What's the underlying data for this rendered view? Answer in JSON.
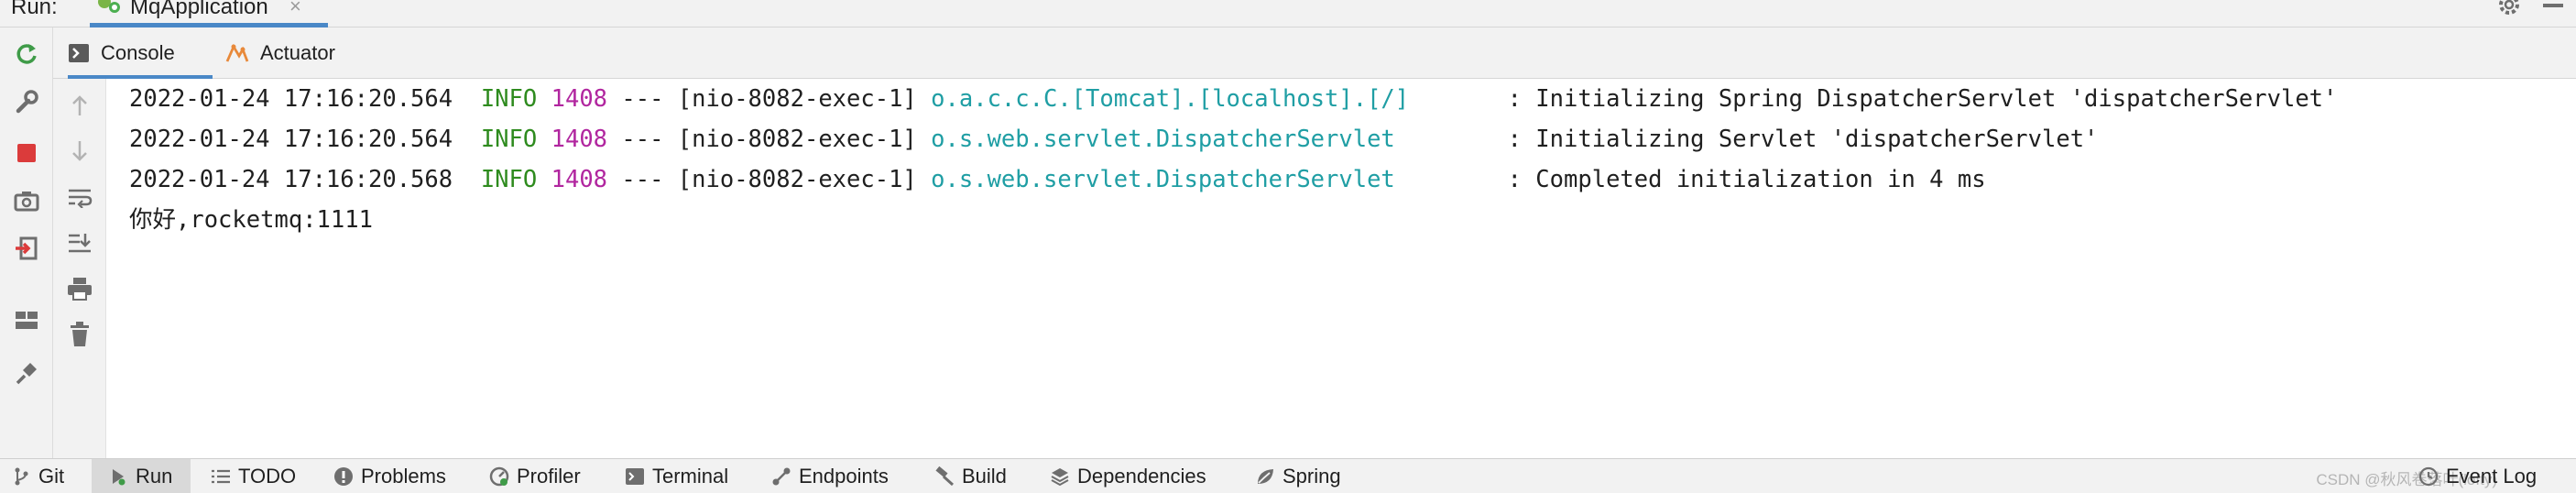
{
  "run_header": {
    "label": "Run:",
    "tab_title": "MqApplication",
    "tab_close": "×"
  },
  "sub_tabs": [
    {
      "label": "Console",
      "active": true
    },
    {
      "label": "Actuator",
      "active": false
    }
  ],
  "console_lines": [
    {
      "timestamp": "2022-01-24 17:16:20.564",
      "level": "INFO",
      "pid": "1408",
      "thread": "--- [nio-8082-exec-1]",
      "logger": "o.a.c.c.C.[Tomcat].[localhost].[/]      ",
      "message": " : Initializing Spring DispatcherServlet 'dispatcherServlet'"
    },
    {
      "timestamp": "2022-01-24 17:16:20.564",
      "level": "INFO",
      "pid": "1408",
      "thread": "--- [nio-8082-exec-1]",
      "logger": "o.s.web.servlet.DispatcherServlet       ",
      "message": " : Initializing Servlet 'dispatcherServlet'"
    },
    {
      "timestamp": "2022-01-24 17:16:20.568",
      "level": "INFO",
      "pid": "1408",
      "thread": "--- [nio-8082-exec-1]",
      "logger": "o.s.web.servlet.DispatcherServlet       ",
      "message": " : Completed initialization in 4 ms"
    }
  ],
  "console_plain": "你好,rocketmq:1111",
  "bottom_bar": [
    {
      "label": "Git",
      "icon": "git-branch-icon"
    },
    {
      "label": "Run",
      "icon": "run-icon",
      "active": true
    },
    {
      "label": "TODO",
      "icon": "todo-list-icon"
    },
    {
      "label": "Problems",
      "icon": "problems-icon"
    },
    {
      "label": "Profiler",
      "icon": "profiler-icon"
    },
    {
      "label": "Terminal",
      "icon": "terminal-icon"
    },
    {
      "label": "Endpoints",
      "icon": "endpoints-icon"
    },
    {
      "label": "Build",
      "icon": "build-hammer-icon"
    },
    {
      "label": "Dependencies",
      "icon": "dependencies-icon"
    },
    {
      "label": "Spring",
      "icon": "spring-leaf-icon"
    }
  ],
  "event_log": "Event Log",
  "watermark": "CSDN @秋风卷落叶(lofty)",
  "colors": {
    "accent": "#4a88c7",
    "info": "#2e8b1e",
    "pid": "#b1269f",
    "logger": "#1f9ea4",
    "stop_red": "#db3b3b",
    "rerun_green": "#3f9b48"
  }
}
